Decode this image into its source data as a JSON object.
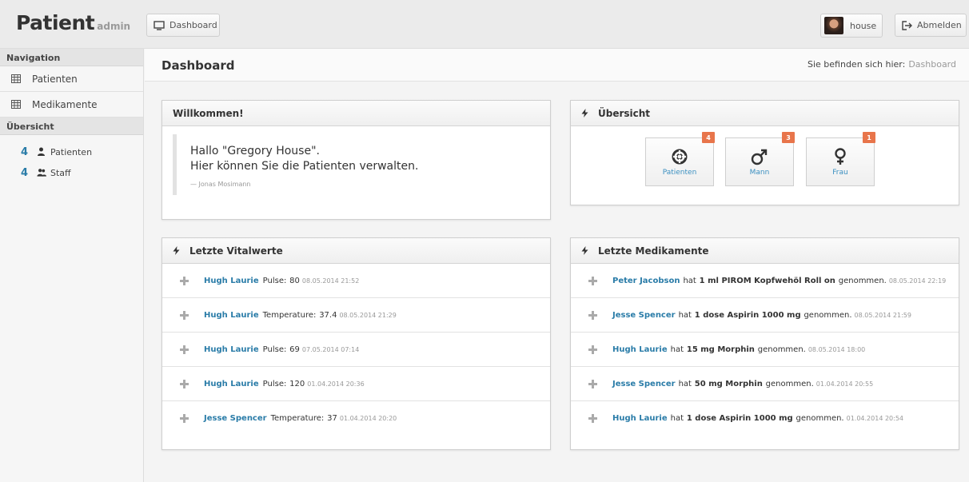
{
  "app": {
    "title": "Patient",
    "subtitle": "admin"
  },
  "topbar": {
    "dashboard_label": "Dashboard",
    "user_label": "house",
    "logout_label": "Abmelden"
  },
  "sidebar": {
    "nav_heading": "Navigation",
    "items": [
      {
        "label": "Patienten",
        "icon": "table-icon"
      },
      {
        "label": "Medikamente",
        "icon": "table-icon"
      }
    ],
    "overview_heading": "Übersicht",
    "stats": [
      {
        "count": "4",
        "label": "Patienten",
        "icon": "user-icon"
      },
      {
        "count": "4",
        "label": "Staff",
        "icon": "users-icon"
      }
    ]
  },
  "header": {
    "title": "Dashboard",
    "crumb_prefix": "Sie befinden sich hier:",
    "crumb_current": "Dashboard"
  },
  "welcome": {
    "title": "Willkommen!",
    "line1": "Hallo \"Gregory House\".",
    "line2": "Hier können Sie die Patienten verwalten.",
    "source": "— Jonas Mosimann"
  },
  "overview": {
    "title": "Übersicht",
    "tiles": [
      {
        "label": "Patienten",
        "badge": "4",
        "icon": "lifebuoy-icon"
      },
      {
        "label": "Mann",
        "badge": "3",
        "icon": "male-icon"
      },
      {
        "label": "Frau",
        "badge": "1",
        "icon": "female-icon"
      }
    ]
  },
  "vitals": {
    "title": "Letzte Vitalwerte",
    "rows": [
      {
        "name": "Hugh Laurie",
        "label": "Pulse:",
        "value": "80",
        "date": "08.05.2014 21:52"
      },
      {
        "name": "Hugh Laurie",
        "label": "Temperature:",
        "value": "37.4",
        "date": "08.05.2014 21:29"
      },
      {
        "name": "Hugh Laurie",
        "label": "Pulse:",
        "value": "69",
        "date": "07.05.2014 07:14"
      },
      {
        "name": "Hugh Laurie",
        "label": "Pulse:",
        "value": "120",
        "date": "01.04.2014 20:36"
      },
      {
        "name": "Jesse Spencer",
        "label": "Temperature:",
        "value": "37",
        "date": "01.04.2014 20:20"
      }
    ]
  },
  "medications": {
    "title": "Letzte Medikamente",
    "verb": "hat",
    "suffix": "genommen.",
    "rows": [
      {
        "name": "Peter Jacobson",
        "drug": "1 ml PIROM Kopfwehöl Roll on",
        "date": "08.05.2014 22:19"
      },
      {
        "name": "Jesse Spencer",
        "drug": "1 dose Aspirin 1000 mg",
        "date": "08.05.2014 21:59"
      },
      {
        "name": "Hugh Laurie",
        "drug": "15 mg Morphin",
        "date": "08.05.2014 18:00"
      },
      {
        "name": "Jesse Spencer",
        "drug": "50 mg Morphin",
        "date": "01.04.2014 20:55"
      },
      {
        "name": "Hugh Laurie",
        "drug": "1 dose Aspirin 1000 mg",
        "date": "01.04.2014 20:54"
      }
    ]
  },
  "colors": {
    "link": "#2a7ca8",
    "badge": "#e8754b"
  }
}
